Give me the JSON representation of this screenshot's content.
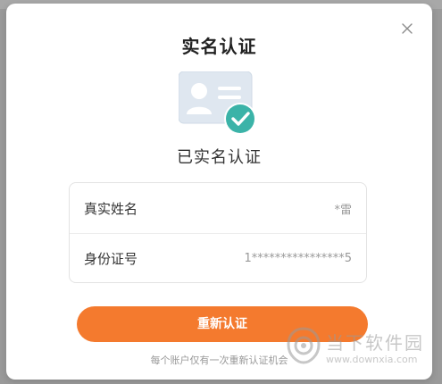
{
  "dialog": {
    "title": "实名认证",
    "status": "已实名认证",
    "close_icon": "close-icon",
    "illustration_icon": "id-card-verified-icon"
  },
  "info": {
    "rows": [
      {
        "label": "真实姓名",
        "value": "*雷"
      },
      {
        "label": "身份证号",
        "value": "1****************5"
      }
    ]
  },
  "actions": {
    "reverify_label": "重新认证",
    "hint": "每个账户仅有一次重新认证机会"
  },
  "watermark": {
    "name": "当下软件园",
    "url": "www.downxia.com"
  },
  "colors": {
    "primary": "#f47a2e",
    "check_badge": "#3bb3a8",
    "card_bg": "#dde6ef"
  }
}
